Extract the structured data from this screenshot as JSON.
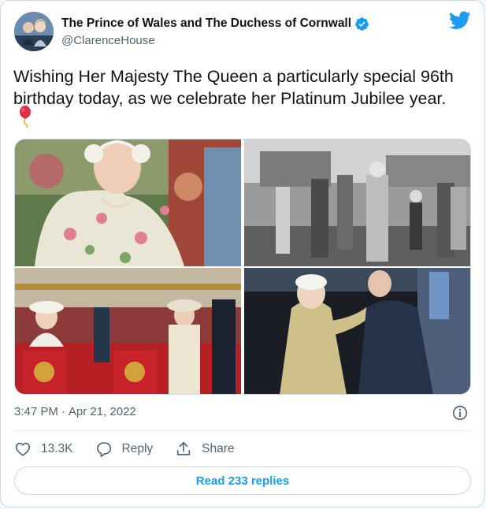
{
  "author": {
    "display_name": "The Prince of Wales and The Duchess of Cornwall",
    "handle": "@ClarenceHouse",
    "verified": true,
    "avatar_icon": "profile-photo"
  },
  "brand_icon": "twitter-bird-icon",
  "colors": {
    "accent": "#1d9bf0",
    "text_primary": "#0f1419",
    "text_secondary": "#536471",
    "border": "#cfd9de"
  },
  "tweet": {
    "text": "Wishing Her Majesty The Queen a particularly special 96th birthday today, as we celebrate her Platinum Jubilee year.",
    "emoji": "balloon"
  },
  "media": {
    "count": 4,
    "photos": [
      {
        "kind": "color photo"
      },
      {
        "kind": "black-and-white photo"
      },
      {
        "kind": "color photo"
      },
      {
        "kind": "color photo"
      }
    ]
  },
  "meta": {
    "time": "3:47 PM",
    "separator": "·",
    "date": "Apr 21, 2022"
  },
  "actions": {
    "like_count": "13.3K",
    "reply_label": "Reply",
    "share_label": "Share"
  },
  "read_replies_label": "Read 233 replies"
}
